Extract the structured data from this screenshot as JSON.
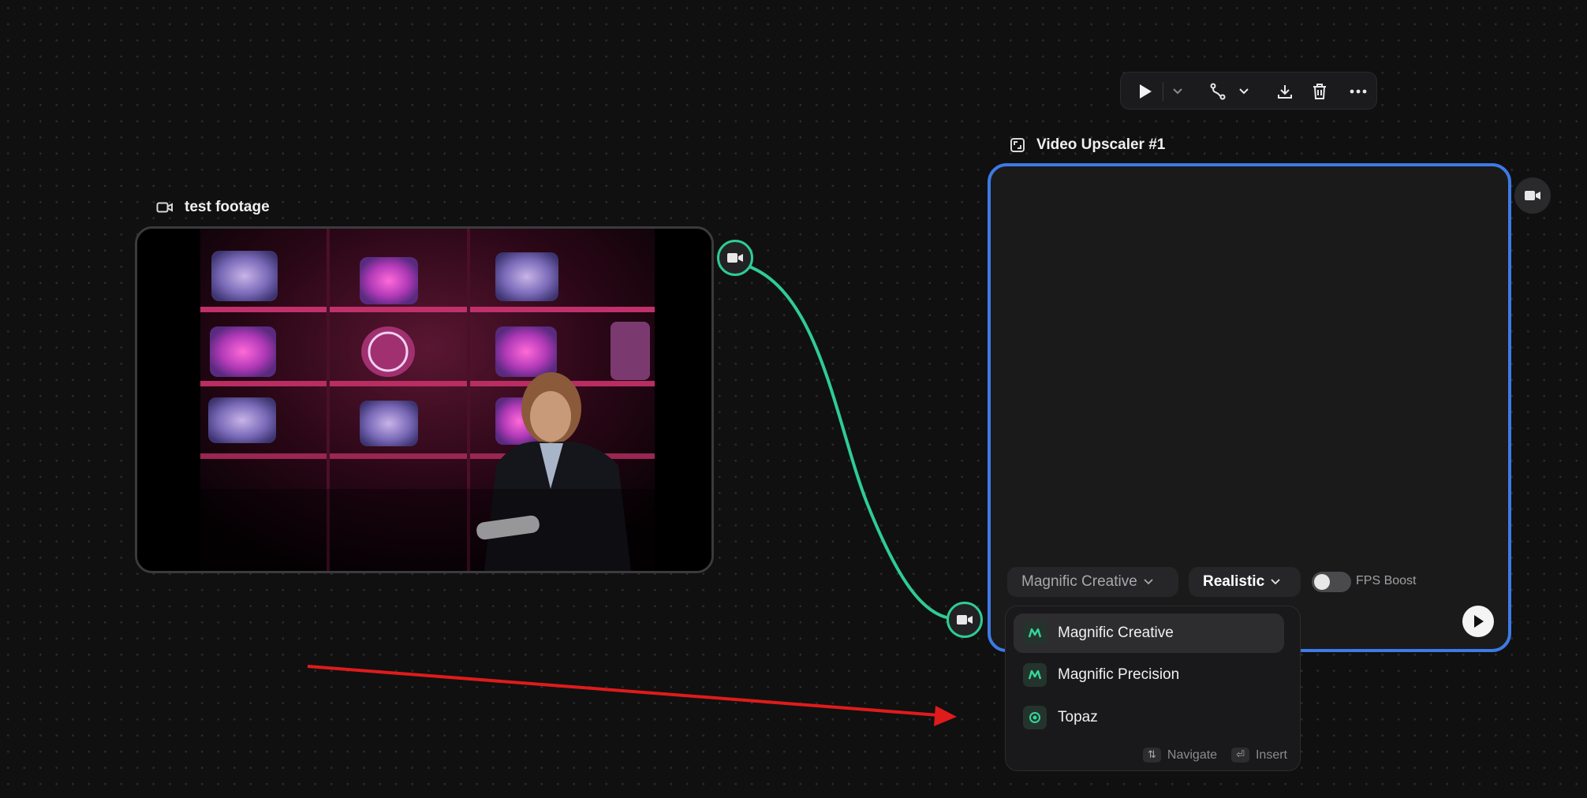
{
  "toolbar": {
    "play_icon": "play-icon",
    "chevron_icon": "chevron-down-icon",
    "connect_icon": "connector-icon",
    "download_icon": "download-icon",
    "delete_icon": "trash-icon",
    "more_icon": "more-icon"
  },
  "source_node": {
    "title": "test footage",
    "icon": "video-camera-icon"
  },
  "upscaler_node": {
    "title": "Video Upscaler #1",
    "icon": "upscale-icon",
    "model_select": "Magnific Creative",
    "style_select": "Realistic",
    "fps_boost_label": "FPS Boost",
    "fps_boost_on": false
  },
  "dropdown": {
    "items": [
      {
        "label": "Magnific Creative",
        "icon": "magnific-icon"
      },
      {
        "label": "Magnific Precision",
        "icon": "magnific-icon"
      },
      {
        "label": "Topaz",
        "icon": "topaz-icon"
      }
    ],
    "footer": {
      "navigate_key": "⇅",
      "navigate_label": "Navigate",
      "insert_key": "⏎",
      "insert_label": "Insert"
    }
  },
  "colors": {
    "edge": "#2fcc94",
    "selection": "#3d7ae5",
    "annotation_arrow": "#e01b1b"
  }
}
